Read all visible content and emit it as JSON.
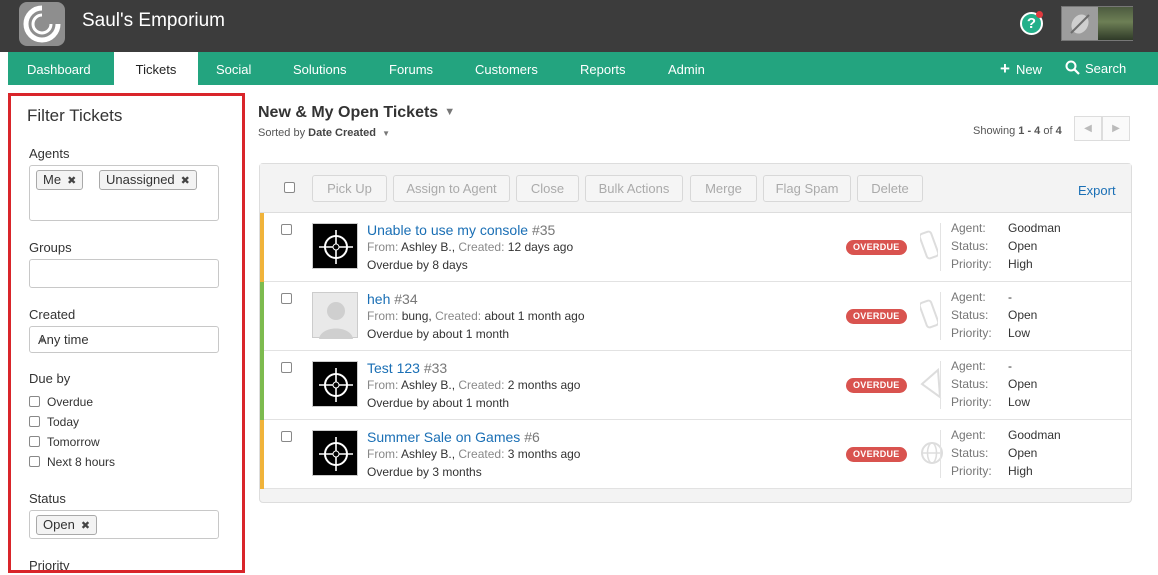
{
  "app": {
    "title": "Saul's Emporium"
  },
  "colors": {
    "header": "#3c3c3c",
    "nav": "#23a47f",
    "accent": "#1a6fb5",
    "overdue": "#d9534f",
    "highlight": "#d9252a"
  },
  "nav": {
    "items": [
      {
        "label": "Dashboard"
      },
      {
        "label": "Tickets",
        "active": true
      },
      {
        "label": "Social"
      },
      {
        "label": "Solutions"
      },
      {
        "label": "Forums"
      },
      {
        "label": "Customers"
      },
      {
        "label": "Reports"
      },
      {
        "label": "Admin"
      }
    ],
    "new_label": "New",
    "search_label": "Search"
  },
  "filter": {
    "title": "Filter Tickets",
    "agents": {
      "label": "Agents",
      "tags": [
        "Me",
        "Unassigned"
      ]
    },
    "groups": {
      "label": "Groups"
    },
    "created": {
      "label": "Created",
      "value": "Any time"
    },
    "due": {
      "label": "Due by",
      "options": [
        "Overdue",
        "Today",
        "Tomorrow",
        "Next 8 hours"
      ]
    },
    "status": {
      "label": "Status",
      "tags": [
        "Open"
      ]
    },
    "priority": {
      "label": "Priority"
    }
  },
  "list": {
    "title": "New & My Open Tickets",
    "sorted_prefix": "Sorted by",
    "sorted_value": "Date Created",
    "showing_prefix": "Showing",
    "showing_range": "1 - 4",
    "showing_of": "of",
    "showing_total": "4",
    "toolbar": [
      "Pick Up",
      "Assign to Agent",
      "Close",
      "Bulk Actions",
      "Merge",
      "Flag Spam",
      "Delete"
    ],
    "export_label": "Export",
    "labels": {
      "from": "From:",
      "created": "Created:",
      "agent": "Agent:",
      "status": "Status:",
      "priority": "Priority:",
      "overdue_badge": "OVERDUE"
    },
    "tickets": [
      {
        "title": "Unable to use my console",
        "number": "#35",
        "from": "Ashley B.",
        "created": "12 days ago",
        "overdue": "Overdue by 8 days",
        "agent": "Goodman",
        "status": "Open",
        "priority": "High",
        "bar_color": "#f0b33a",
        "channel": "phone-icon",
        "avatar": "crosshair"
      },
      {
        "title": "heh",
        "number": "#34",
        "from": "bung",
        "created": "about 1 month ago",
        "overdue": "Overdue by about 1 month",
        "agent": "-",
        "status": "Open",
        "priority": "Low",
        "bar_color": "#7dbb4f",
        "channel": "phone-icon",
        "avatar": "blank"
      },
      {
        "title": "Test 123",
        "number": "#33",
        "from": "Ashley B.",
        "created": "2 months ago",
        "overdue": "Overdue by about 1 month",
        "agent": "-",
        "status": "Open",
        "priority": "Low",
        "bar_color": "#7dbb4f",
        "channel": "email-icon",
        "avatar": "crosshair"
      },
      {
        "title": "Summer Sale on Games",
        "number": "#6",
        "from": "Ashley B.",
        "created": "3 months ago",
        "overdue": "Overdue by 3 months",
        "agent": "Goodman",
        "status": "Open",
        "priority": "High",
        "bar_color": "#f0b33a",
        "channel": "globe-icon",
        "avatar": "crosshair"
      }
    ]
  }
}
